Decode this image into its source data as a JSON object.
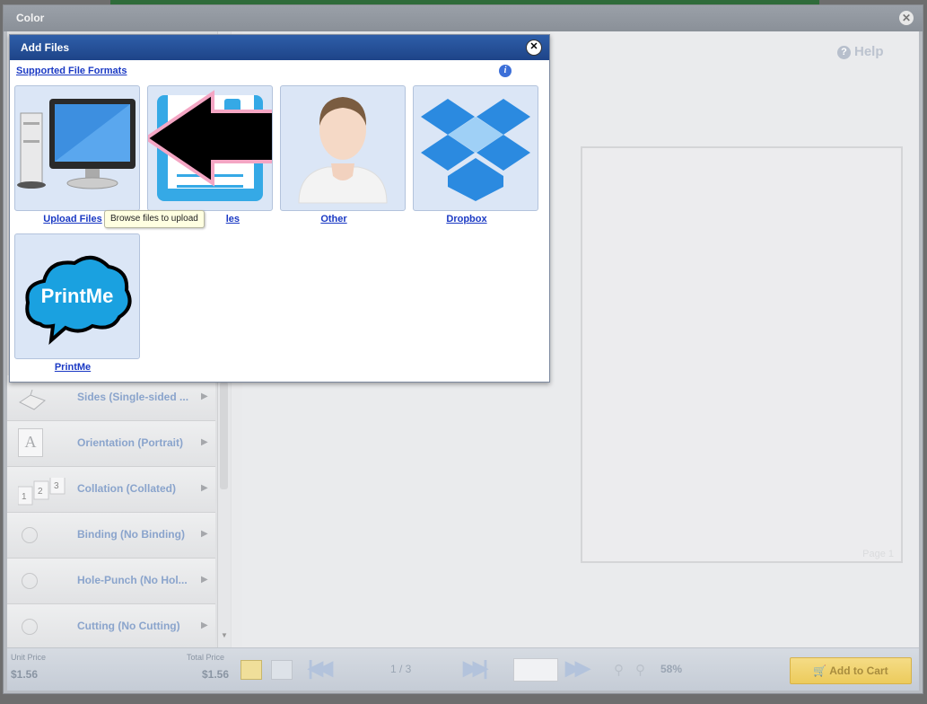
{
  "window": {
    "title": "Color",
    "close_label": "✕"
  },
  "help": {
    "label": "Help",
    "icon": "question-icon"
  },
  "options": [
    {
      "label": "Sides (Single-sided ...",
      "icon": "sides-icon"
    },
    {
      "label": "Orientation (Portrait)",
      "icon": "orientation-icon",
      "glyph": "A"
    },
    {
      "label": "Collation (Collated)",
      "icon": "collation-icon",
      "glyph": "1 2 3"
    },
    {
      "label": "Binding (No Binding)",
      "icon": "radio-circle-icon"
    },
    {
      "label": "Hole-Punch (No Hol...",
      "icon": "radio-circle-icon"
    },
    {
      "label": "Cutting (No Cutting)",
      "icon": "radio-circle-icon"
    }
  ],
  "preview": {
    "page_label": "Page 1"
  },
  "footer": {
    "unit_price_label": "Unit Price",
    "unit_price": "$1.56",
    "total_price_label": "Total Price",
    "total_price": "$1.56",
    "page_count": "1 / 3",
    "zoom": "58%",
    "add_to_cart": "Add to Cart"
  },
  "dialog": {
    "title": "Add Files",
    "close_label": "✕",
    "formats_link": "Supported File Formats",
    "info_glyph": "i",
    "tiles": [
      {
        "label": "Upload Files",
        "icon": "computer-monitor-icon"
      },
      {
        "label": "les",
        "icon": "document-files-icon"
      },
      {
        "label": "Other",
        "icon": "user-avatar-icon"
      },
      {
        "label": "Dropbox",
        "icon": "dropbox-icon"
      },
      {
        "label": "PrintMe",
        "icon": "printme-cloud-icon",
        "logo_text": "PrintMe"
      }
    ],
    "tooltip": "Browse files to upload"
  },
  "colors": {
    "dialog_title": "#1e4488",
    "link": "#1a39c4",
    "tile_bg": "#dbe6f6",
    "arrow_outline": "#f4a6c4",
    "dropbox": "#2b8ae0"
  }
}
